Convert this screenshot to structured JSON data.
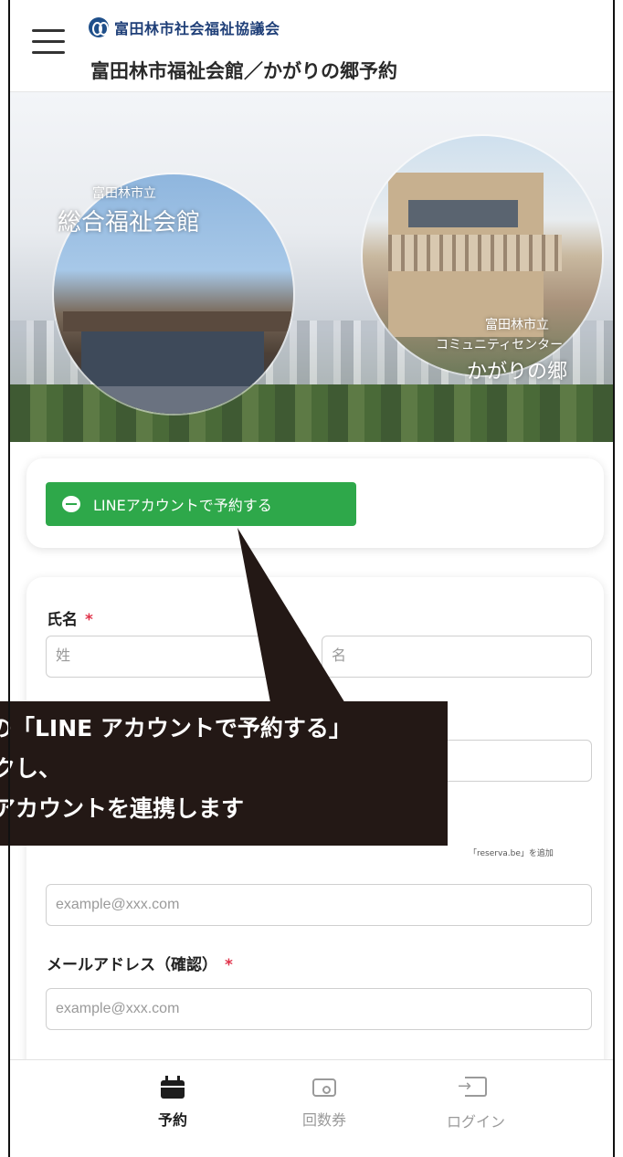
{
  "header": {
    "org_name": "富田林市社会福祉協議会",
    "title": "富田林市福祉会館／かがりの郷予約"
  },
  "hero": {
    "left": {
      "small": "富田林市立",
      "big": "総合福祉会館"
    },
    "right": {
      "line1": "富田林市立",
      "line2": "コミュニティセンター",
      "line3": "かがりの郷"
    }
  },
  "line_card": {
    "button_label": "LINEアカウントで予約する"
  },
  "form": {
    "name_label": "氏名",
    "required_mark": "*",
    "last_name_placeholder": "姓",
    "first_name_placeholder": "名",
    "email_hint": "「reserva.be」を追加",
    "email_placeholder": "example@xxx.com",
    "email_confirm_label": "メールアドレス（確認）",
    "email_confirm_placeholder": "example@xxx.com"
  },
  "callout": {
    "line1": "の「LINE アカウントで予約する」",
    "line2": "クし、",
    "line3": "アカウントを連携します"
  },
  "bottom_nav": {
    "items": [
      {
        "label": "予約",
        "icon": "calendar-icon",
        "active": true
      },
      {
        "label": "回数券",
        "icon": "ticket-icon",
        "active": false
      },
      {
        "label": "ログイン",
        "icon": "login-icon",
        "active": false
      }
    ]
  },
  "colors": {
    "line_green": "#2ea84a",
    "required_red": "#e0334a",
    "callout_bg": "#231815",
    "org_blue": "#1f3f78"
  }
}
